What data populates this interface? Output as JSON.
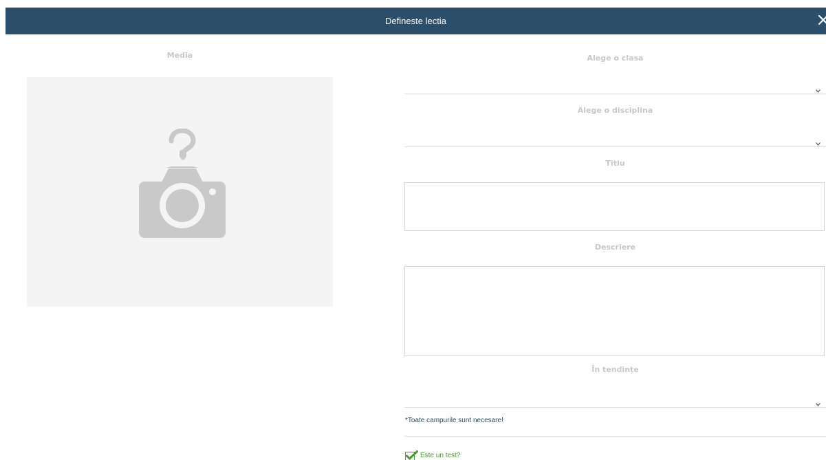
{
  "header": {
    "title": "Defineste lectia",
    "close_icon": "close-icon"
  },
  "media": {
    "label": "Media",
    "placeholder_icon": "camera-question-icon"
  },
  "form": {
    "class_label": "Alege o clasa",
    "class_value": "",
    "discipline_label": "Alege o disciplina",
    "discipline_value": "",
    "title_label": "Titlu",
    "title_value": "",
    "description_label": "Descriere",
    "description_value": "",
    "trending_label": "În tendințe",
    "trending_value": "",
    "required_note": "*Toate campurile sunt necesare!",
    "test_checkbox_label": "Este un test?",
    "test_checked": true
  },
  "colors": {
    "header_bg": "#2b4f6a",
    "label_gray": "#c8c8c8",
    "note_blue": "#2b4f6a",
    "check_green": "#4a9a2a"
  }
}
